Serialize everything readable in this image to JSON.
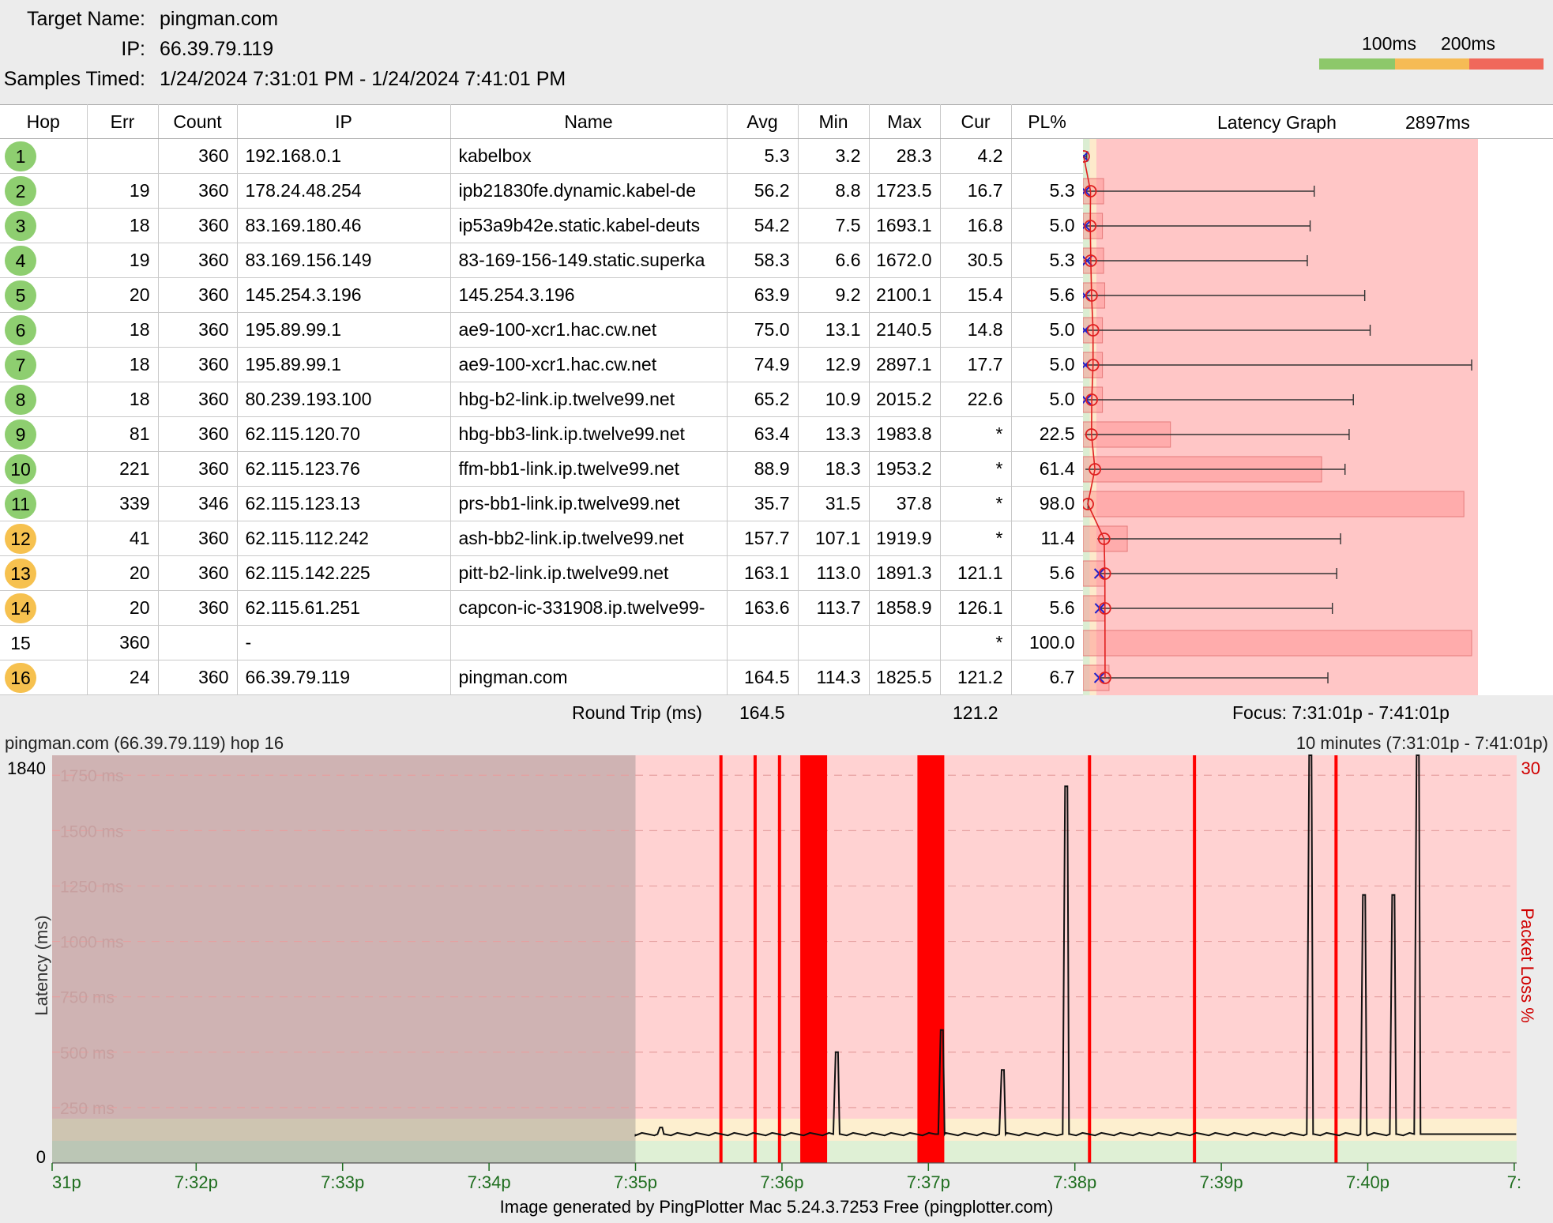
{
  "header": {
    "target_label": "Target Name:",
    "target_value": "pingman.com",
    "ip_label": "IP:",
    "ip_value": "66.39.79.119",
    "samples_label": "Samples Timed:",
    "samples_value": "1/24/2024 7:31:01 PM - 1/24/2024 7:41:01 PM",
    "scale_label_1": "100ms",
    "scale_label_2": "200ms",
    "scale_colors": [
      "#8dc86a",
      "#f6bb55",
      "#f0685b"
    ]
  },
  "columns": {
    "hop": "Hop",
    "err": "Err",
    "count": "Count",
    "ip": "IP",
    "name": "Name",
    "avg": "Avg",
    "min": "Min",
    "max": "Max",
    "cur": "Cur",
    "pl": "PL%",
    "latency_graph": "Latency Graph",
    "latency_max": "2897ms"
  },
  "hops": [
    {
      "hop": "1",
      "color": "green",
      "err": "",
      "count": "360",
      "ip": "192.168.0.1",
      "name": "kabelbox",
      "avg": "5.3",
      "min": "3.2",
      "max": "28.3",
      "cur": "4.2",
      "pl": "",
      "avg_ms": 5.3,
      "min_ms": 3.2,
      "max_ms": 28.3,
      "cur_ms": 4.2,
      "pl_pct": 0
    },
    {
      "hop": "2",
      "color": "green",
      "err": "19",
      "count": "360",
      "ip": "178.24.48.254",
      "name": "ipb21830fe.dynamic.kabel-de",
      "avg": "56.2",
      "min": "8.8",
      "max": "1723.5",
      "cur": "16.7",
      "pl": "5.3",
      "avg_ms": 56.2,
      "min_ms": 8.8,
      "max_ms": 1723.5,
      "cur_ms": 16.7,
      "pl_pct": 5.3
    },
    {
      "hop": "3",
      "color": "green",
      "err": "18",
      "count": "360",
      "ip": "83.169.180.46",
      "name": "ip53a9b42e.static.kabel-deuts",
      "avg": "54.2",
      "min": "7.5",
      "max": "1693.1",
      "cur": "16.8",
      "pl": "5.0",
      "avg_ms": 54.2,
      "min_ms": 7.5,
      "max_ms": 1693.1,
      "cur_ms": 16.8,
      "pl_pct": 5.0
    },
    {
      "hop": "4",
      "color": "green",
      "err": "19",
      "count": "360",
      "ip": "83.169.156.149",
      "name": "83-169-156-149.static.superka",
      "avg": "58.3",
      "min": "6.6",
      "max": "1672.0",
      "cur": "30.5",
      "pl": "5.3",
      "avg_ms": 58.3,
      "min_ms": 6.6,
      "max_ms": 1672.0,
      "cur_ms": 30.5,
      "pl_pct": 5.3
    },
    {
      "hop": "5",
      "color": "green",
      "err": "20",
      "count": "360",
      "ip": "145.254.3.196",
      "name": "145.254.3.196",
      "avg": "63.9",
      "min": "9.2",
      "max": "2100.1",
      "cur": "15.4",
      "pl": "5.6",
      "avg_ms": 63.9,
      "min_ms": 9.2,
      "max_ms": 2100.1,
      "cur_ms": 15.4,
      "pl_pct": 5.6
    },
    {
      "hop": "6",
      "color": "green",
      "err": "18",
      "count": "360",
      "ip": "195.89.99.1",
      "name": "ae9-100-xcr1.hac.cw.net",
      "avg": "75.0",
      "min": "13.1",
      "max": "2140.5",
      "cur": "14.8",
      "pl": "5.0",
      "avg_ms": 75.0,
      "min_ms": 13.1,
      "max_ms": 2140.5,
      "cur_ms": 14.8,
      "pl_pct": 5.0
    },
    {
      "hop": "7",
      "color": "green",
      "err": "18",
      "count": "360",
      "ip": "195.89.99.1",
      "name": "ae9-100-xcr1.hac.cw.net",
      "avg": "74.9",
      "min": "12.9",
      "max": "2897.1",
      "cur": "17.7",
      "pl": "5.0",
      "avg_ms": 74.9,
      "min_ms": 12.9,
      "max_ms": 2897.1,
      "cur_ms": 17.7,
      "pl_pct": 5.0
    },
    {
      "hop": "8",
      "color": "green",
      "err": "18",
      "count": "360",
      "ip": "80.239.193.100",
      "name": "hbg-b2-link.ip.twelve99.net",
      "avg": "65.2",
      "min": "10.9",
      "max": "2015.2",
      "cur": "22.6",
      "pl": "5.0",
      "avg_ms": 65.2,
      "min_ms": 10.9,
      "max_ms": 2015.2,
      "cur_ms": 22.6,
      "pl_pct": 5.0
    },
    {
      "hop": "9",
      "color": "green",
      "err": "81",
      "count": "360",
      "ip": "62.115.120.70",
      "name": "hbg-bb3-link.ip.twelve99.net",
      "avg": "63.4",
      "min": "13.3",
      "max": "1983.8",
      "cur": "*",
      "pl": "22.5",
      "avg_ms": 63.4,
      "min_ms": 13.3,
      "max_ms": 1983.8,
      "cur_ms": null,
      "pl_pct": 22.5
    },
    {
      "hop": "10",
      "color": "green",
      "err": "221",
      "count": "360",
      "ip": "62.115.123.76",
      "name": "ffm-bb1-link.ip.twelve99.net",
      "avg": "88.9",
      "min": "18.3",
      "max": "1953.2",
      "cur": "*",
      "pl": "61.4",
      "avg_ms": 88.9,
      "min_ms": 18.3,
      "max_ms": 1953.2,
      "cur_ms": null,
      "pl_pct": 61.4
    },
    {
      "hop": "11",
      "color": "green",
      "err": "339",
      "count": "346",
      "ip": "62.115.123.13",
      "name": "prs-bb1-link.ip.twelve99.net",
      "avg": "35.7",
      "min": "31.5",
      "max": "37.8",
      "cur": "*",
      "pl": "98.0",
      "avg_ms": 35.7,
      "min_ms": 31.5,
      "max_ms": 37.8,
      "cur_ms": null,
      "pl_pct": 98.0
    },
    {
      "hop": "12",
      "color": "orange",
      "err": "41",
      "count": "360",
      "ip": "62.115.112.242",
      "name": "ash-bb2-link.ip.twelve99.net",
      "avg": "157.7",
      "min": "107.1",
      "max": "1919.9",
      "cur": "*",
      "pl": "11.4",
      "avg_ms": 157.7,
      "min_ms": 107.1,
      "max_ms": 1919.9,
      "cur_ms": null,
      "pl_pct": 11.4
    },
    {
      "hop": "13",
      "color": "orange",
      "err": "20",
      "count": "360",
      "ip": "62.115.142.225",
      "name": "pitt-b2-link.ip.twelve99.net",
      "avg": "163.1",
      "min": "113.0",
      "max": "1891.3",
      "cur": "121.1",
      "pl": "5.6",
      "avg_ms": 163.1,
      "min_ms": 113.0,
      "max_ms": 1891.3,
      "cur_ms": 121.1,
      "pl_pct": 5.6
    },
    {
      "hop": "14",
      "color": "orange",
      "err": "20",
      "count": "360",
      "ip": "62.115.61.251",
      "name": "capcon-ic-331908.ip.twelve99-",
      "avg": "163.6",
      "min": "113.7",
      "max": "1858.9",
      "cur": "126.1",
      "pl": "5.6",
      "avg_ms": 163.6,
      "min_ms": 113.7,
      "max_ms": 1858.9,
      "cur_ms": 126.1,
      "pl_pct": 5.6
    },
    {
      "hop": "15",
      "color": "none",
      "err": "360",
      "count": "",
      "ip": "-",
      "name": "",
      "avg": "",
      "min": "",
      "max": "",
      "cur": "*",
      "pl": "100.0",
      "avg_ms": null,
      "min_ms": null,
      "max_ms": null,
      "cur_ms": null,
      "pl_pct": 100.0
    },
    {
      "hop": "16",
      "color": "orange",
      "err": "24",
      "count": "360",
      "ip": "66.39.79.119",
      "name": "pingman.com",
      "avg": "164.5",
      "min": "114.3",
      "max": "1825.5",
      "cur": "121.2",
      "pl": "6.7",
      "avg_ms": 164.5,
      "min_ms": 114.3,
      "max_ms": 1825.5,
      "cur_ms": 121.2,
      "pl_pct": 6.7
    }
  ],
  "roundtrip": {
    "label": "Round Trip (ms)",
    "avg": "164.5",
    "cur": "121.2",
    "focus": "Focus: 7:31:01p - 7:41:01p"
  },
  "timeline": {
    "title_left": "pingman.com (66.39.79.119) hop 16",
    "title_right": "10 minutes (7:31:01p - 7:41:01p)",
    "y_top": "1840",
    "y_bottom": "0",
    "right_top": "30",
    "ylabel": "Latency (ms)",
    "y2label": "Packet Loss %",
    "gridlines": [
      "1750 ms",
      "1500 ms",
      "1250 ms",
      "1000 ms",
      "750 ms",
      "500 ms",
      "250 ms"
    ],
    "x_labels": [
      "31p",
      "7:32p",
      "7:33p",
      "7:34p",
      "7:35p",
      "7:36p",
      "7:37p",
      "7:38p",
      "7:39p",
      "7:40p",
      "7:"
    ]
  },
  "chart_data": {
    "type": "line",
    "title": "pingman.com (66.39.79.119) hop 16",
    "xlabel": "",
    "ylabel": "Latency (ms)",
    "y2label": "Packet Loss %",
    "ylim": [
      0,
      1840
    ],
    "y2lim": [
      0,
      30
    ],
    "x_range": [
      "7:31:01p",
      "7:41:01p"
    ],
    "x_ticks": [
      "31p",
      "7:32p",
      "7:33p",
      "7:34p",
      "7:35p",
      "7:36p",
      "7:37p",
      "7:38p",
      "7:39p",
      "7:40p",
      "7:"
    ],
    "no_data_before": "7:35p",
    "baseline_ms": 130,
    "latency_spikes": [
      {
        "t": "7:35:10p",
        "ms": 160
      },
      {
        "t": "7:36:22p",
        "ms": 500
      },
      {
        "t": "7:37:05p",
        "ms": 600
      },
      {
        "t": "7:37:30p",
        "ms": 420
      },
      {
        "t": "7:37:56p",
        "ms": 1700
      },
      {
        "t": "7:39:36p",
        "ms": 1840
      },
      {
        "t": "7:39:58p",
        "ms": 1210
      },
      {
        "t": "7:40:10p",
        "ms": 1210
      },
      {
        "t": "7:40:20p",
        "ms": 1840
      }
    ],
    "packet_loss_events": [
      {
        "t": "7:35:35p",
        "width": "thin"
      },
      {
        "t": "7:35:49p",
        "width": "thin"
      },
      {
        "t": "7:35:59p",
        "width": "thin"
      },
      {
        "t": "7:36:13p",
        "width": "wide"
      },
      {
        "t": "7:37:01p",
        "width": "wide"
      },
      {
        "t": "7:38:06p",
        "width": "thin"
      },
      {
        "t": "7:38:49p",
        "width": "thin"
      },
      {
        "t": "7:39:47p",
        "width": "thin"
      }
    ]
  },
  "footer": {
    "text": "Image generated by PingPlotter Mac 5.24.3.7253 Free (pingplotter.com)"
  }
}
